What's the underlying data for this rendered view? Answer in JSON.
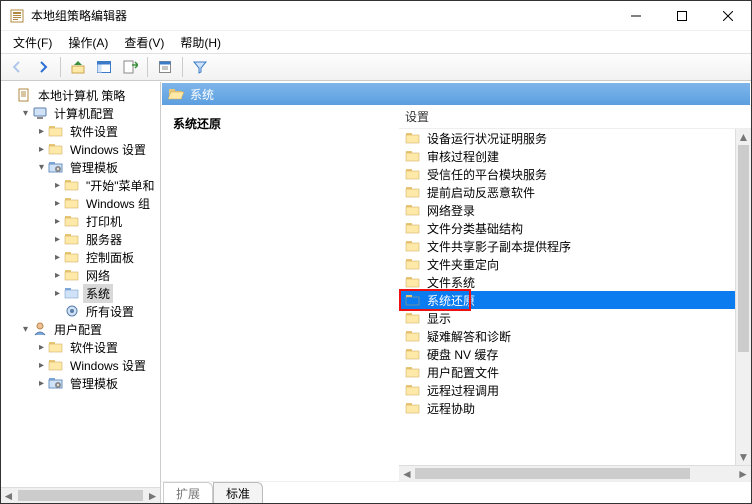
{
  "window": {
    "title": "本地组策略编辑器"
  },
  "menubar": [
    "文件(F)",
    "操作(A)",
    "查看(V)",
    "帮助(H)"
  ],
  "tree": {
    "root": "本地计算机 策略",
    "computer": {
      "label": "计算机配置",
      "soft": "软件设置",
      "win": "Windows 设置",
      "admin": "管理模板",
      "admin_children": [
        "\"开始\"菜单和",
        "Windows 组",
        "打印机",
        "服务器",
        "控制面板",
        "网络",
        "系统",
        "所有设置"
      ]
    },
    "user": {
      "label": "用户配置",
      "soft": "软件设置",
      "win": "Windows 设置",
      "admin": "管理模板"
    }
  },
  "header": {
    "path": "系统"
  },
  "left_panel": {
    "title": "系统还原"
  },
  "list": {
    "column": "设置",
    "items": [
      "设备运行状况证明服务",
      "审核过程创建",
      "受信任的平台模块服务",
      "提前启动反恶意软件",
      "网络登录",
      "文件分类基础结构",
      "文件共享影子副本提供程序",
      "文件夹重定向",
      "文件系统",
      "系统还原",
      "显示",
      "疑难解答和诊断",
      "硬盘 NV 缓存",
      "用户配置文件",
      "远程过程调用",
      "远程协助"
    ],
    "selected_index": 9
  },
  "tabs": {
    "extended": "扩展",
    "standard": "标准"
  }
}
